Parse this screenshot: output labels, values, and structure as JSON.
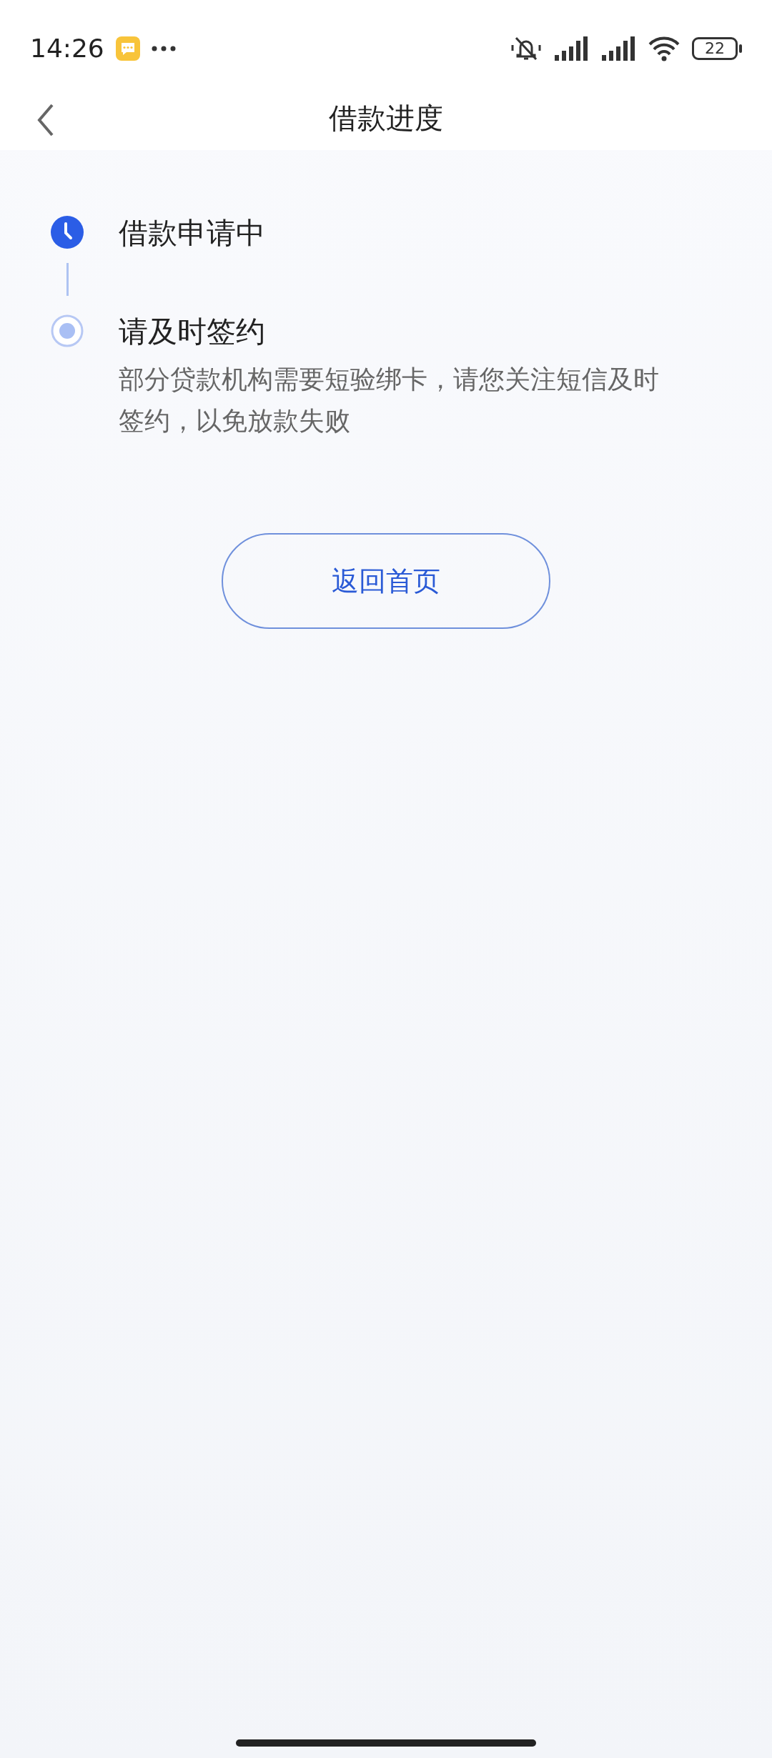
{
  "status_bar": {
    "time": "14:26",
    "battery": "22"
  },
  "header": {
    "title": "借款进度"
  },
  "steps": [
    {
      "kind": "clock",
      "title": "借款申请中"
    },
    {
      "kind": "dot",
      "title": "请及时签约",
      "description": "部分贷款机构需要短验绑卡，请您关注短信及时签约，以免放款失败"
    }
  ],
  "button": {
    "label": "返回首页"
  }
}
